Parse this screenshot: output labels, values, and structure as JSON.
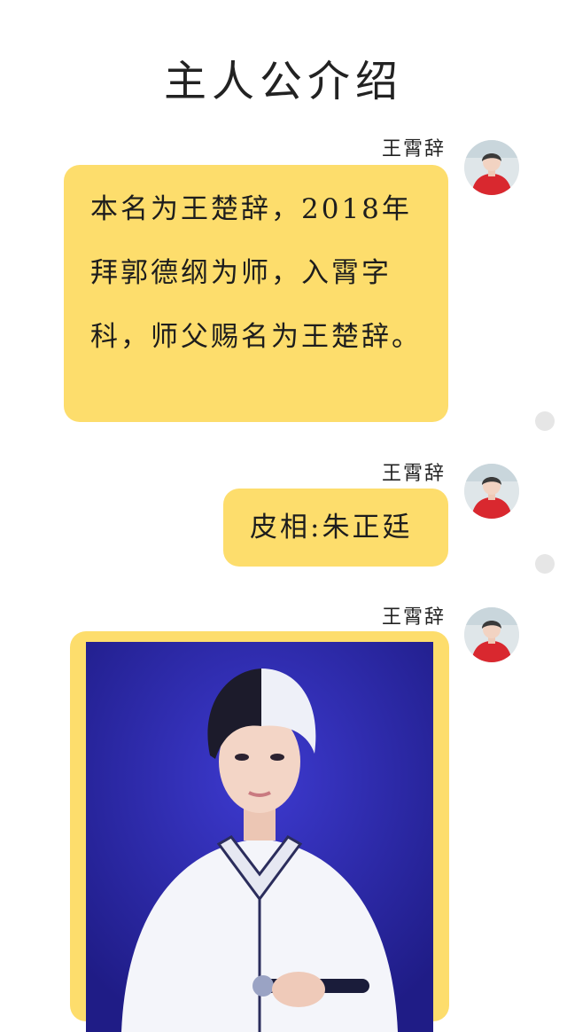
{
  "page": {
    "title": "主人公介绍"
  },
  "messages": [
    {
      "sender": "王霄辞",
      "type": "text",
      "text": "本名为王楚辞，2018年拜郭德纲为师，入霄字科，师父赐名为王楚辞。"
    },
    {
      "sender": "王霄辞",
      "type": "text",
      "text": "皮相:朱正廷"
    },
    {
      "sender": "王霄辞",
      "type": "image"
    }
  ],
  "colors": {
    "bubble": "#fddd6c",
    "background": "#ffffff",
    "photo_background": "#2f2ba8",
    "status_dot": "#e6e6e6"
  },
  "icons": {
    "avatar": "avatar-icon",
    "status_dot": "status-dot-icon"
  }
}
